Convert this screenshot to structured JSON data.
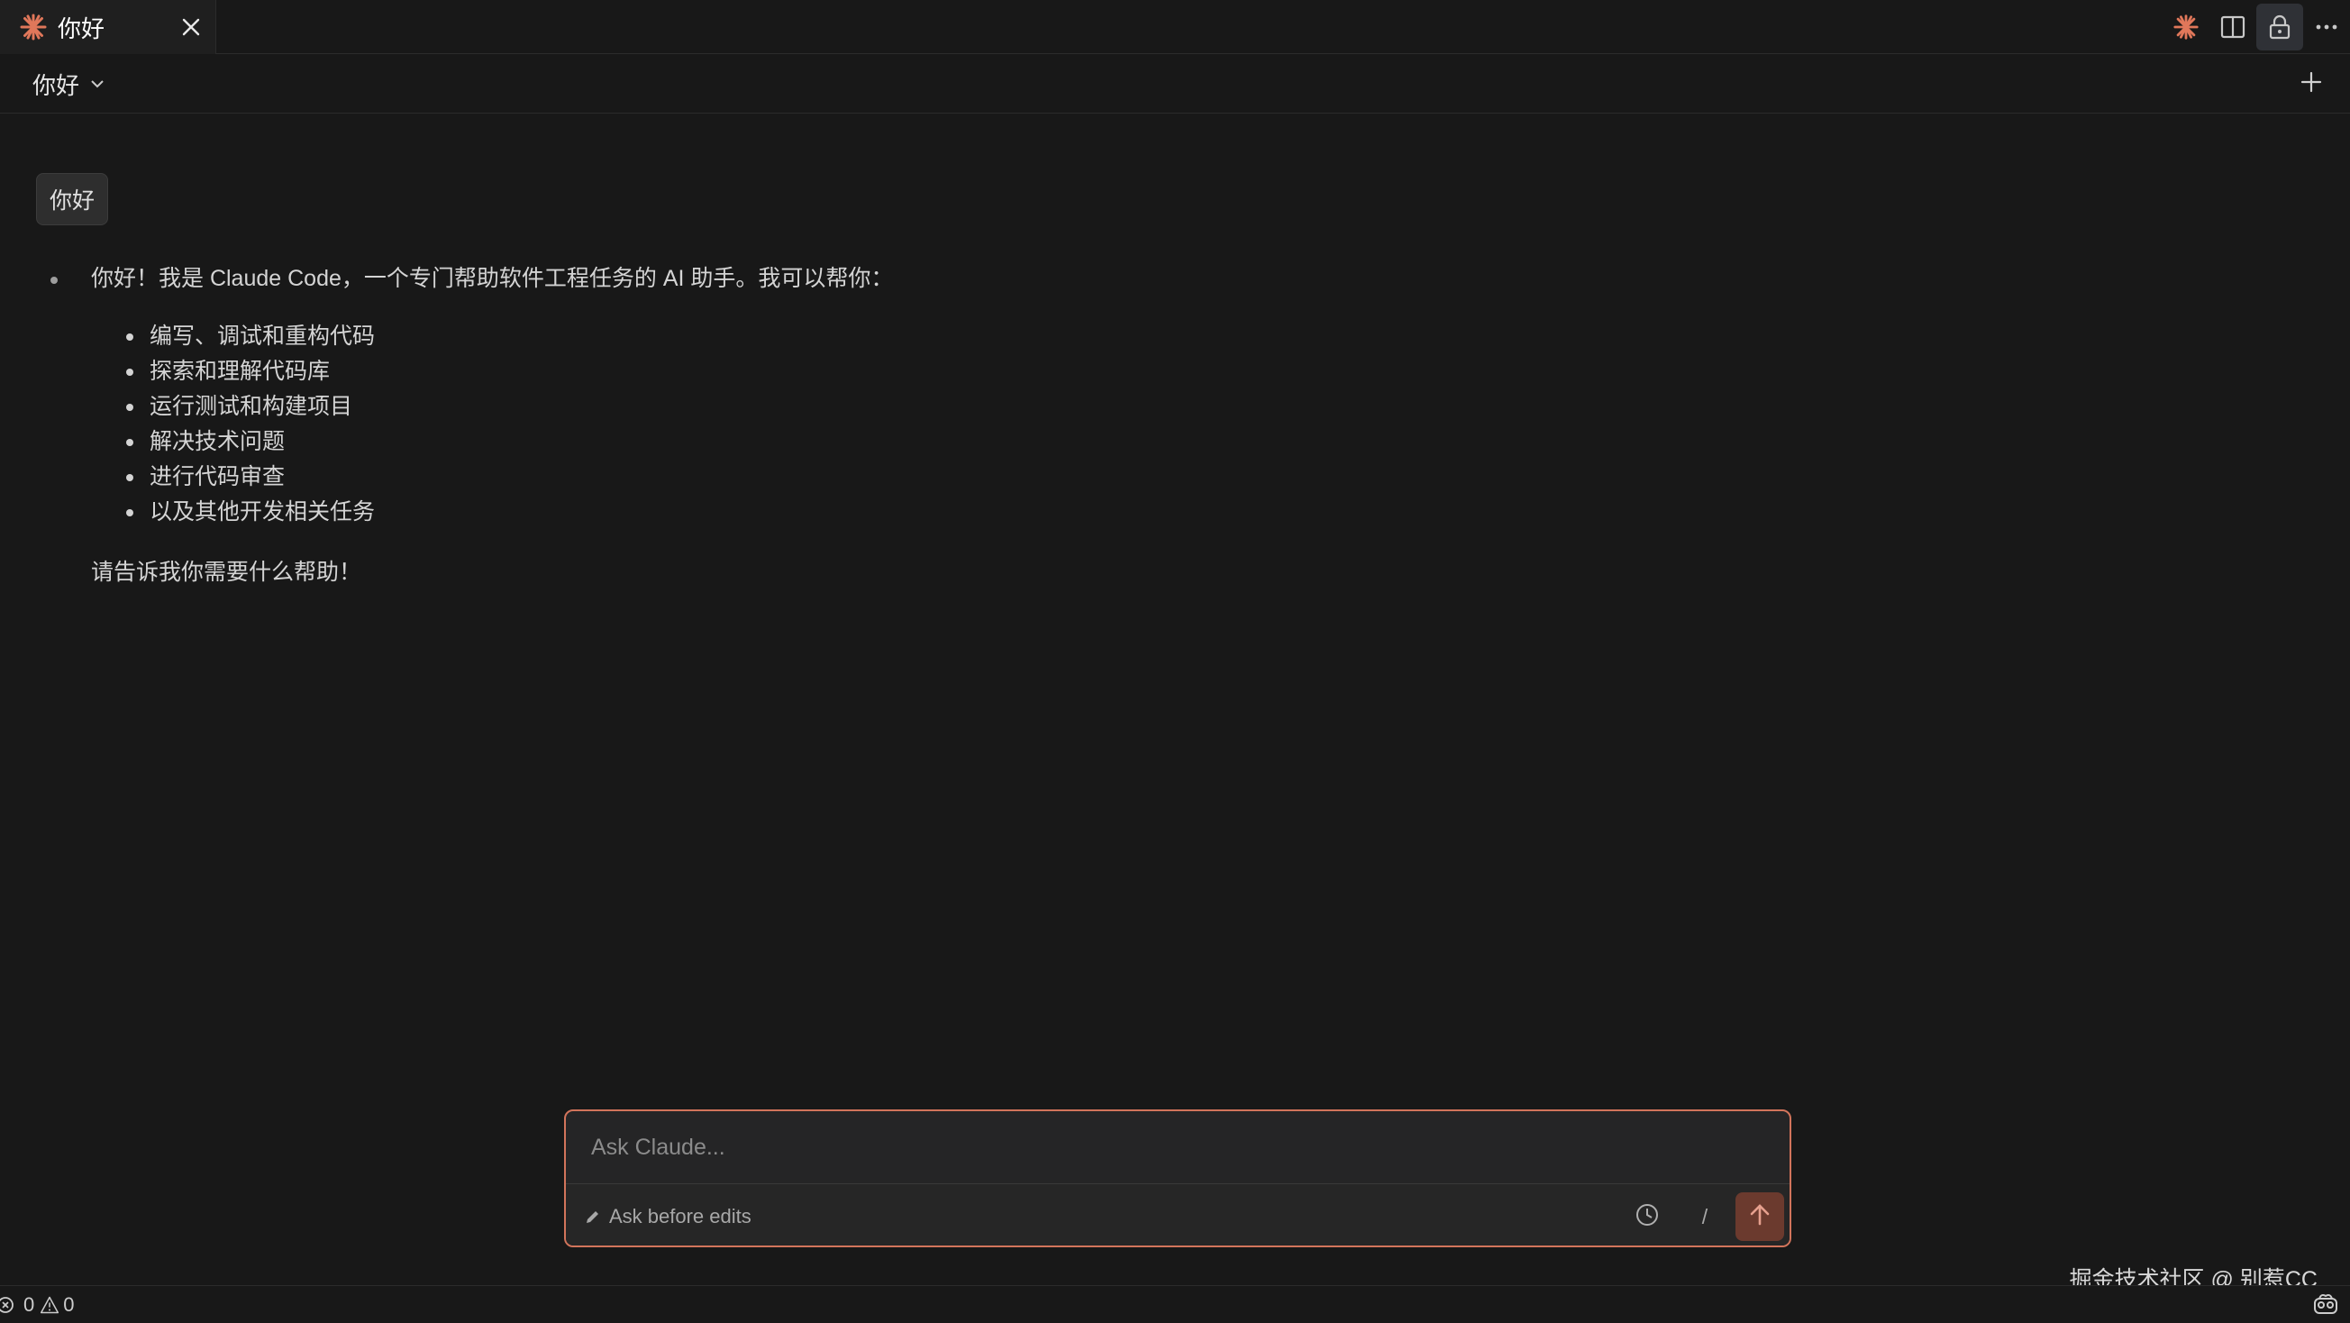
{
  "tab": {
    "title": "你好",
    "icon": "claude-logo-icon",
    "close_icon": "close-icon"
  },
  "top_icons": [
    "claude-logo-icon",
    "split-editor-icon",
    "lock-icon",
    "more-icon"
  ],
  "header": {
    "session_label": "你好",
    "dropdown_icon": "chevron-down-icon",
    "new_icon": "plus-icon"
  },
  "conversation": {
    "user_message": "你好",
    "assistant": {
      "intro": "你好！我是 Claude Code，一个专门帮助软件工程任务的 AI 助手。我可以帮你：",
      "items": [
        "编写、调试和重构代码",
        "探索和理解代码库",
        "运行测试和构建项目",
        "解决技术问题",
        "进行代码审查",
        "以及其他开发相关任务"
      ],
      "outro": "请告诉我你需要什么帮助！"
    }
  },
  "composer": {
    "placeholder": "Ask Claude...",
    "mode_label": "Ask before edits",
    "slash_label": "/",
    "accent_color": "#d2745b",
    "send_color": "#6b3a2e"
  },
  "watermark": "掘金技术社区 @ 别惹CC",
  "status": {
    "errors": "0",
    "warnings": "0"
  }
}
